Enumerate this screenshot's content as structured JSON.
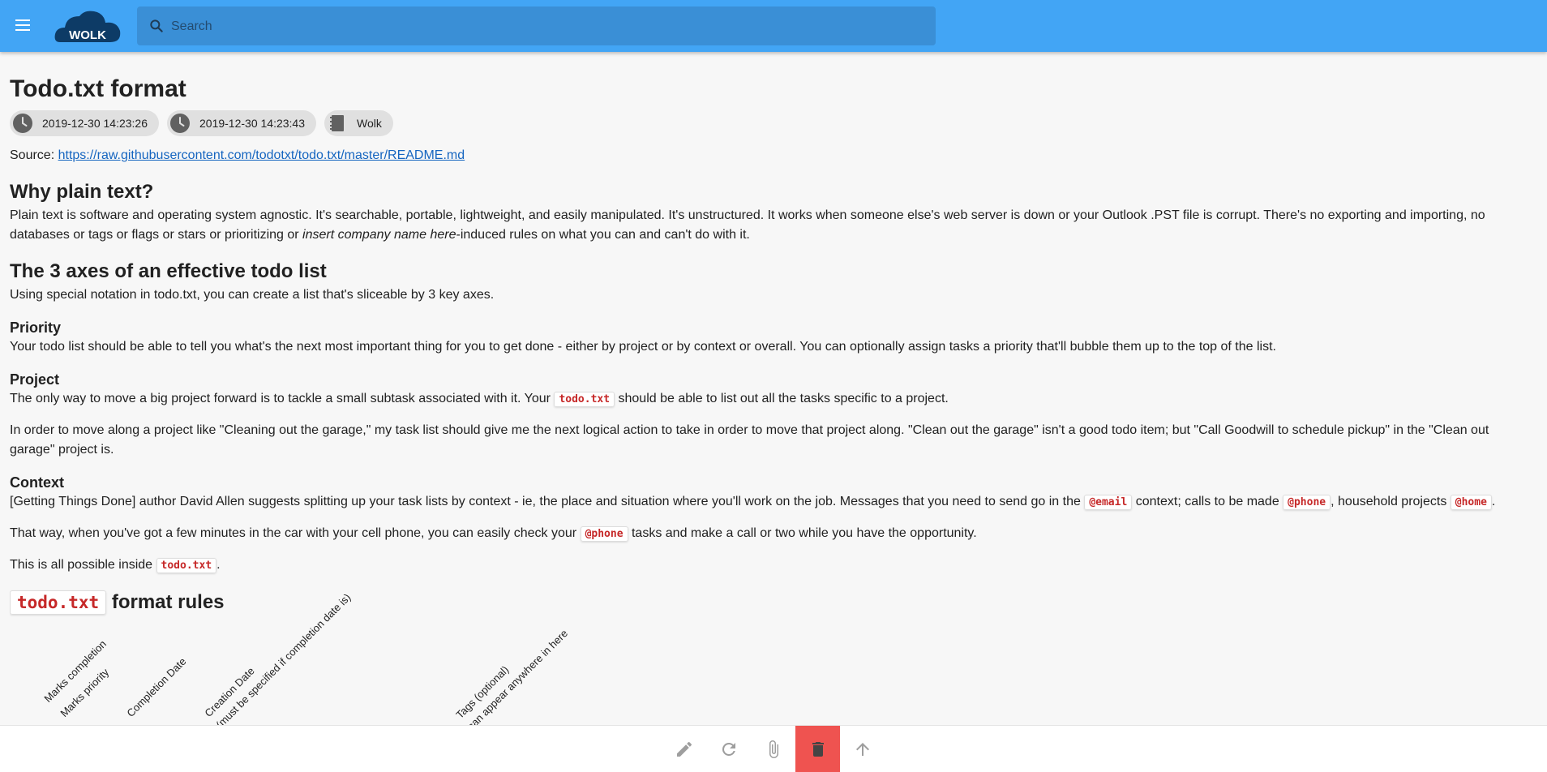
{
  "header": {
    "logo_text": "WOLK",
    "search_placeholder": "Search"
  },
  "note": {
    "title": "Todo.txt format",
    "chips": [
      {
        "icon": "clock-icon",
        "label": "2019-12-30 14:23:26"
      },
      {
        "icon": "clock-icon",
        "label": "2019-12-30 14:23:43"
      },
      {
        "icon": "notebook-icon",
        "label": "Wolk"
      }
    ],
    "source_label": "Source: ",
    "source_url": "https://raw.githubusercontent.com/todotxt/todo.txt/master/README.md"
  },
  "sections": {
    "why": {
      "heading": "Why plain text?",
      "p_part1": "Plain text is software and operating system agnostic. It's searchable, portable, lightweight, and easily manipulated. It's unstructured. It works when someone else's web server is down or your Outlook .PST file is corrupt. There's no exporting and importing, no databases or tags or flags or stars or prioritizing or ",
      "p_em": "insert company name here",
      "p_part2": "-induced rules on what you can and can't do with it."
    },
    "axes": {
      "heading": "The 3 axes of an effective todo list",
      "p": "Using special notation in todo.txt, you can create a list that's sliceable by 3 key axes."
    },
    "priority": {
      "heading": "Priority",
      "p": "Your todo list should be able to tell you what's the next most important thing for you to get done - either by project or by context or overall. You can optionally assign tasks a priority that'll bubble them up to the top of the list."
    },
    "project": {
      "heading": "Project",
      "p1_a": "The only way to move a big project forward is to tackle a small subtask associated with it. Your ",
      "p1_code": "todo.txt",
      "p1_b": " should be able to list out all the tasks specific to a project.",
      "p2": "In order to move along a project like \"Cleaning out the garage,\" my task list should give me the next logical action to take in order to move that project along. \"Clean out the garage\" isn't a good todo item; but \"Call Goodwill to schedule pickup\" in the \"Clean out garage\" project is."
    },
    "context": {
      "heading": "Context",
      "p1_a": "[Getting Things Done] author David Allen suggests splitting up your task lists by context - ie, the place and situation where you'll work on the job. Messages that you need to send go in the ",
      "p1_code1": "@email",
      "p1_b": " context; calls to be made ",
      "p1_code2": "@phone",
      "p1_c": ", household projects ",
      "p1_code3": "@home",
      "p1_d": ".",
      "p2_a": "That way, when you've got a few minutes in the car with your cell phone, you can easily check your ",
      "p2_code": "@phone",
      "p2_b": " tasks and make a call or two while you have the opportunity.",
      "p3_a": "This is all possible inside ",
      "p3_code": "todo.txt",
      "p3_b": "."
    },
    "rules": {
      "heading_code": "todo.txt",
      "heading_text": " format rules",
      "diagram_labels": [
        "Marks completion",
        "Marks priority",
        "Completion Date",
        "Creation Date",
        "(must be specified if completion date is)",
        "Tags (optional)",
        "can appear anywhere in here"
      ]
    }
  },
  "bottombar": {
    "buttons": [
      {
        "name": "edit-button",
        "icon": "pencil-icon"
      },
      {
        "name": "refresh-button",
        "icon": "refresh-icon"
      },
      {
        "name": "attach-button",
        "icon": "paperclip-icon"
      },
      {
        "name": "delete-button",
        "icon": "trash-icon"
      },
      {
        "name": "scroll-top-button",
        "icon": "arrow-up-icon"
      }
    ],
    "delete_color": "#ef5350"
  },
  "colors": {
    "appbar": "#42a5f5",
    "code_text": "#c62828",
    "link": "#1565c0"
  }
}
